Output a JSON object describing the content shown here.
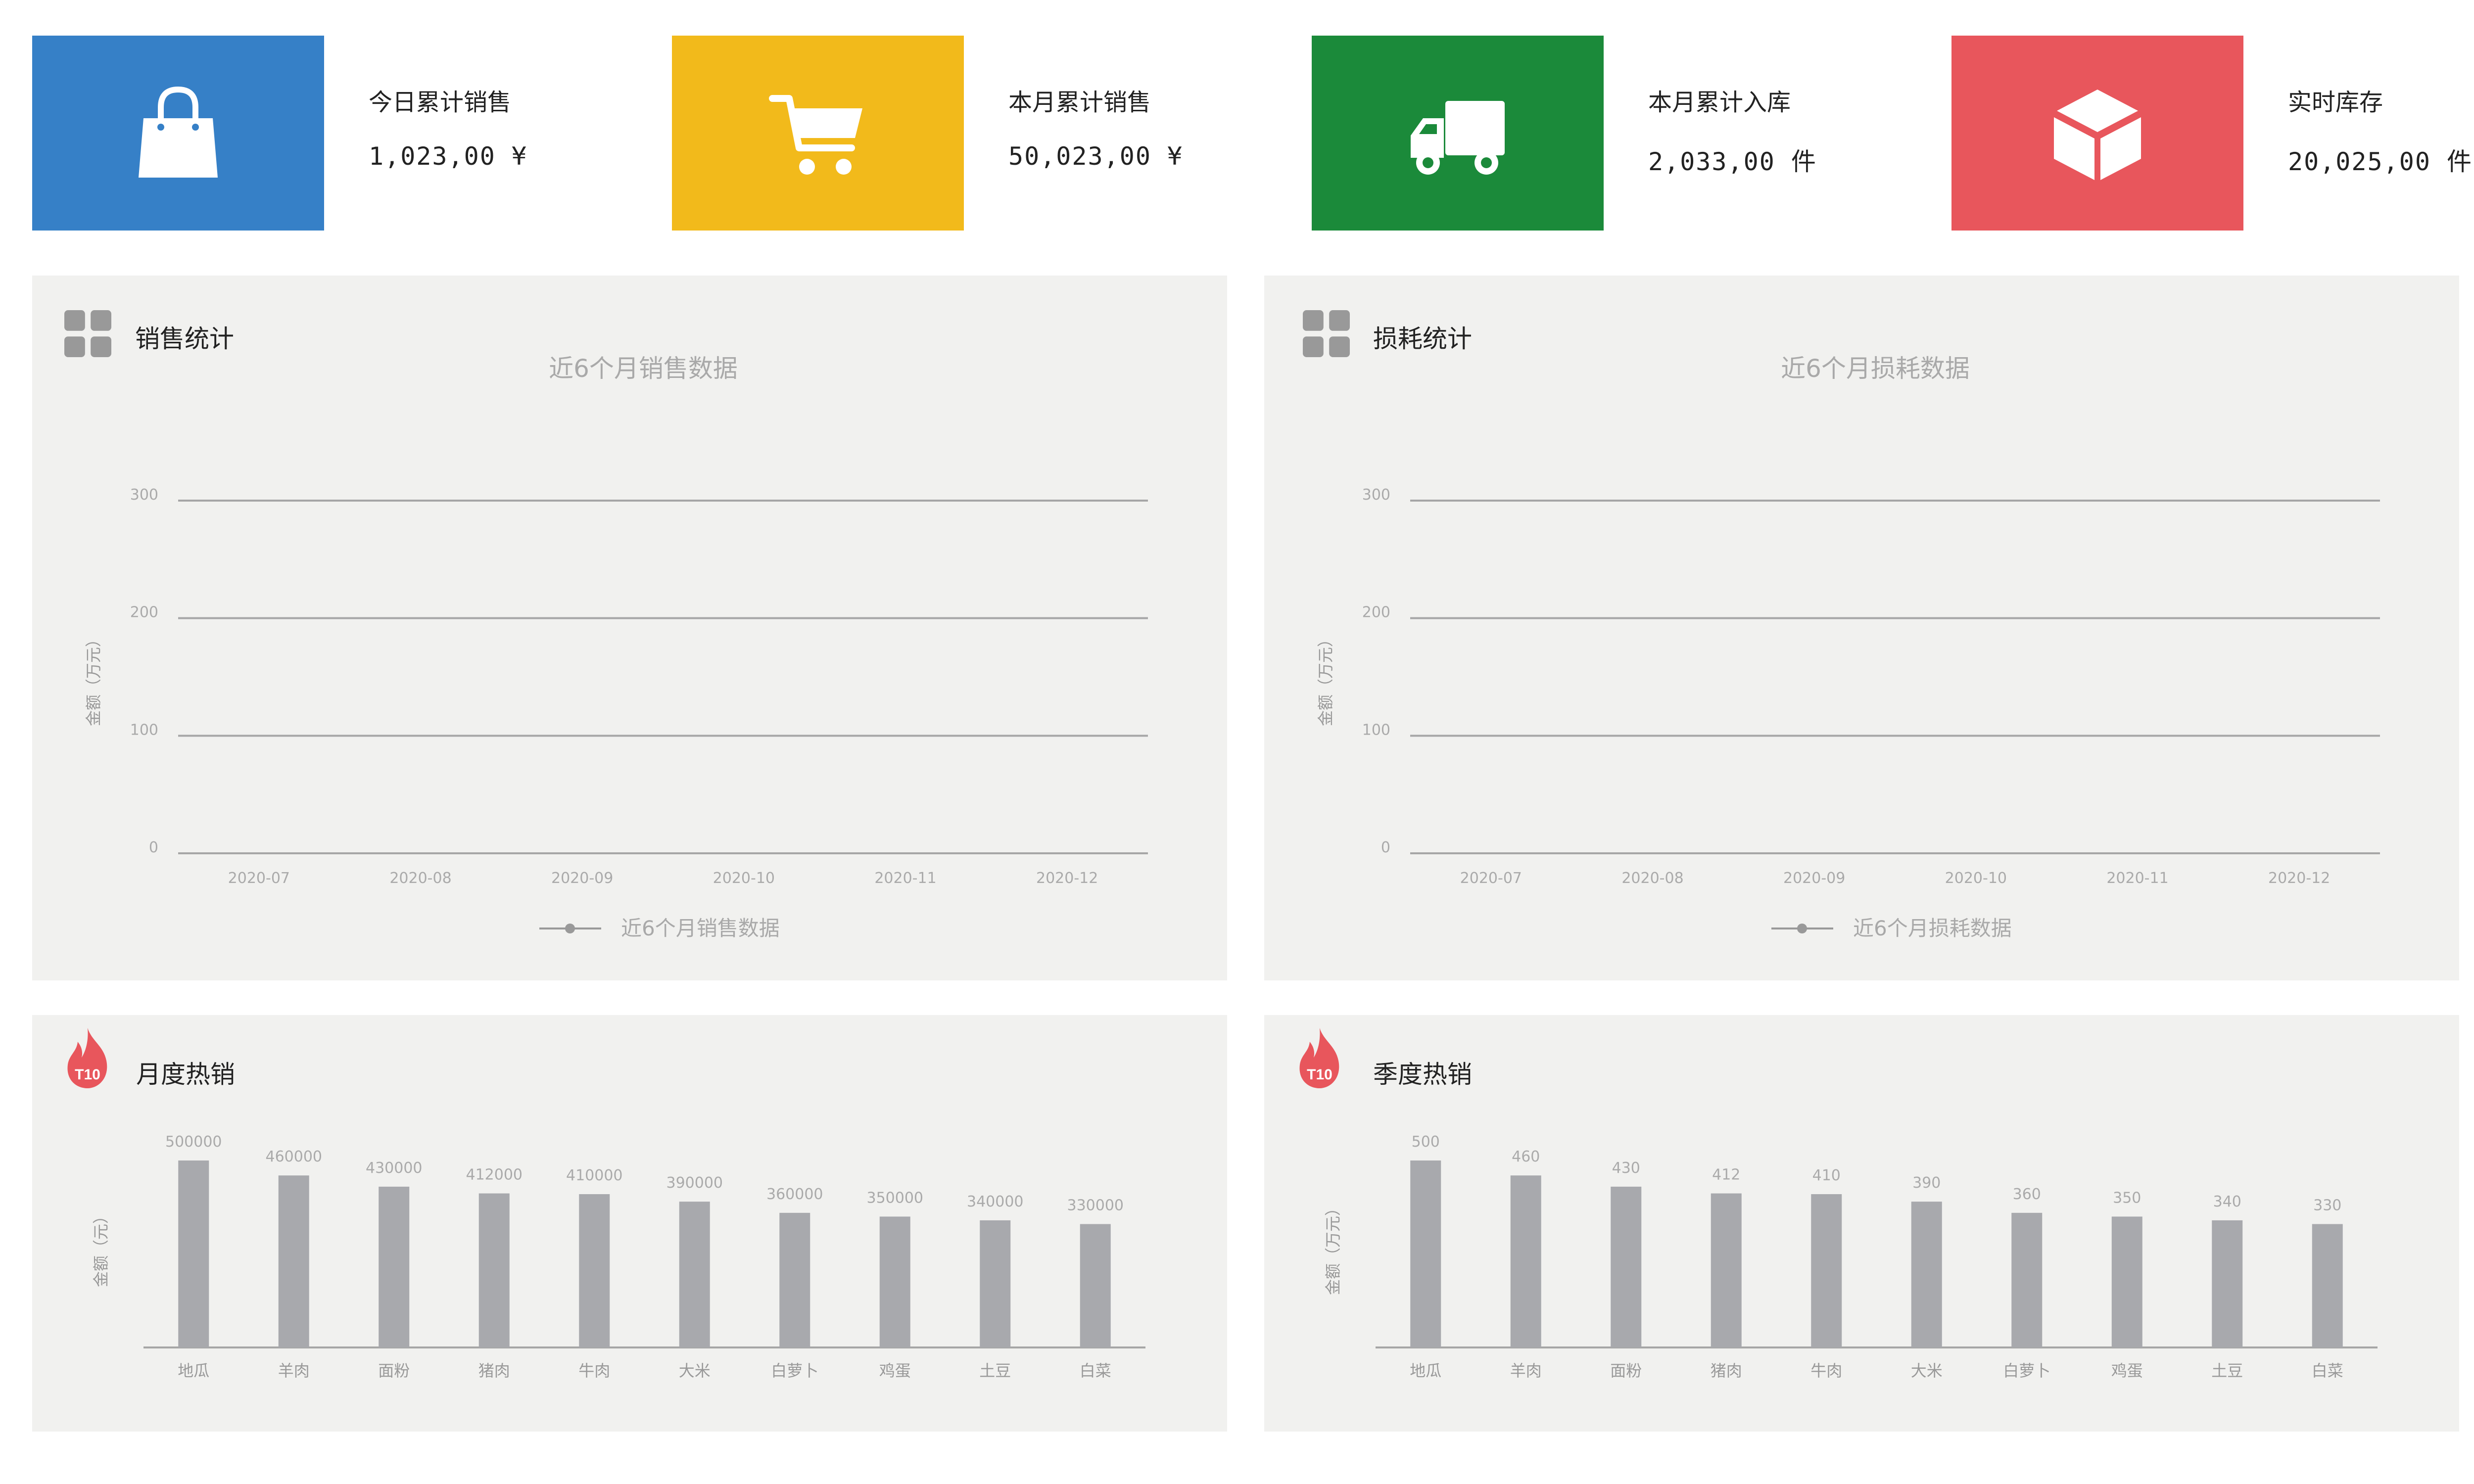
{
  "stats": [
    {
      "label": "今日累计销售",
      "value": "1,023,00 ¥",
      "color": "#3680c7",
      "icon": "shopping-bag-icon"
    },
    {
      "label": "本月累计销售",
      "value": "50,023,00 ¥",
      "color": "#f2ba1b",
      "icon": "shopping-cart-icon"
    },
    {
      "label": "本月累计入库",
      "value": "2,033,00 件",
      "color": "#1b8a3a",
      "icon": "delivery-truck-icon"
    },
    {
      "label": "实时库存",
      "value": "20,025,00 件",
      "color": "#e8565c",
      "icon": "box-cube-icon"
    }
  ],
  "sales_panel": {
    "title": "销售统计",
    "icon": "grid-icon"
  },
  "loss_panel": {
    "title": "损耗统计",
    "icon": "grid-icon"
  },
  "monthly_panel": {
    "title": "月度热销",
    "icon": "fire-t10-icon",
    "badge": "T10"
  },
  "quarterly_panel": {
    "title": "季度热销",
    "icon": "fire-t10-icon",
    "badge": "T10"
  },
  "chart_data": [
    {
      "type": "line",
      "title": "近6个月销售数据",
      "ylabel": "金额（万元）",
      "categories": [
        "2020-07",
        "2020-08",
        "2020-09",
        "2020-10",
        "2020-11",
        "2020-12"
      ],
      "yticks": [
        "0",
        "100",
        "200",
        "300"
      ],
      "ylim": [
        0,
        300
      ],
      "series": [
        {
          "name": "近6个月销售数据",
          "values": []
        }
      ],
      "legend": "bottom",
      "grid": true
    },
    {
      "type": "line",
      "title": "近6个月损耗数据",
      "ylabel": "金额（万元）",
      "categories": [
        "2020-07",
        "2020-08",
        "2020-09",
        "2020-10",
        "2020-11",
        "2020-12"
      ],
      "yticks": [
        "0",
        "100",
        "200",
        "300"
      ],
      "ylim": [
        0,
        300
      ],
      "series": [
        {
          "name": "近6个月损耗数据",
          "values": []
        }
      ],
      "legend": "bottom",
      "grid": true
    },
    {
      "type": "bar",
      "ylabel": "金额（元）",
      "categories": [
        "地瓜",
        "羊肉",
        "面粉",
        "猪肉",
        "牛肉",
        "大米",
        "白萝卜",
        "鸡蛋",
        "土豆",
        "白菜"
      ],
      "values": [
        500000,
        460000,
        430000,
        412000,
        410000,
        390000,
        360000,
        350000,
        340000,
        330000
      ],
      "labels": [
        "500000",
        "460000",
        "430000",
        "412000",
        "410000",
        "390000",
        "360000",
        "350000",
        "340000",
        "330000"
      ],
      "ylim": [
        0,
        500000
      ]
    },
    {
      "type": "bar",
      "ylabel": "金额（万元）",
      "categories": [
        "地瓜",
        "羊肉",
        "面粉",
        "猪肉",
        "牛肉",
        "大米",
        "白萝卜",
        "鸡蛋",
        "土豆",
        "白菜"
      ],
      "values": [
        500,
        460,
        430,
        412,
        410,
        390,
        360,
        350,
        340,
        330
      ],
      "labels": [
        "500",
        "460",
        "430",
        "412",
        "410",
        "390",
        "360",
        "350",
        "340",
        "330"
      ],
      "ylim": [
        0,
        500
      ]
    }
  ]
}
